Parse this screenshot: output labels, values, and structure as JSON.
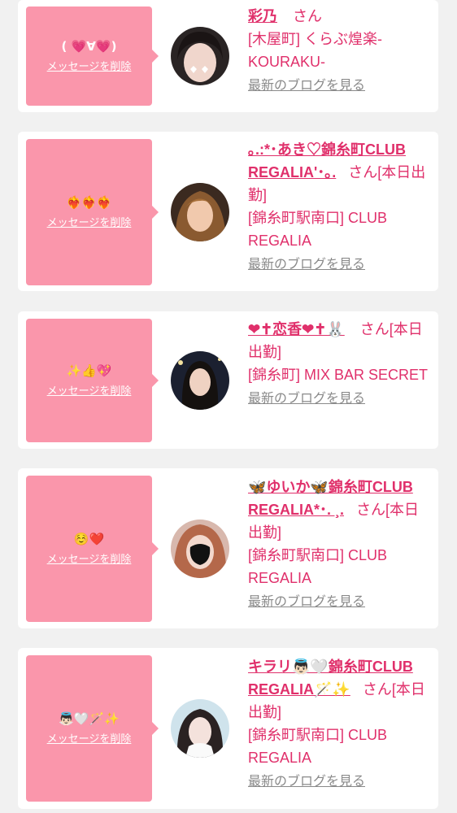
{
  "cards": [
    {
      "message": "( 💗∀💗)",
      "delete_label": "メッセージを削除",
      "name": "彩乃",
      "suffix": "さん",
      "shop": "[木屋町] くらぶ煌楽-KOURAKU-",
      "blog_link": "最新のブログを見る"
    },
    {
      "message": "❤️‍🔥❤️‍🔥❤️‍🔥",
      "delete_label": "メッセージを削除",
      "name": "｡.:*･あき♡錦糸町CLUB REGALIA'･｡.",
      "suffix": "さん[本日出勤]",
      "shop": "[錦糸町駅南口] CLUB REGALIA",
      "blog_link": "最新のブログを見る"
    },
    {
      "message": "✨👍💖",
      "delete_label": "メッセージを削除",
      "name": "❤✝恋香❤✝🐰",
      "suffix": "さん[本日出勤]",
      "shop": "[錦糸町] MIX BAR SECRET",
      "blog_link": "最新のブログを見る"
    },
    {
      "message": "☺️❤️",
      "delete_label": "メッセージを削除",
      "name": "🦋ゆいか🦋錦糸町CLUB REGALIA*･. ¸.",
      "suffix": "さん[本日出勤]",
      "shop": "[錦糸町駅南口] CLUB REGALIA",
      "blog_link": "最新のブログを見る"
    },
    {
      "message": "👼🏻🤍🪄✨",
      "delete_label": "メッセージを削除",
      "name": "キラリ👼🏻🤍錦糸町CLUB REGALIA🪄✨",
      "suffix": "さん[本日出勤]",
      "shop": "[錦糸町駅南口] CLUB REGALIA",
      "blog_link": "最新のブログを見る"
    }
  ],
  "colors": {
    "background": "#f1f1f1",
    "card": "#ffffff",
    "bubble": "#fa96ab",
    "accent": "#e0306b",
    "muted": "#8a8a8a"
  },
  "icons": [
    "avatar"
  ]
}
